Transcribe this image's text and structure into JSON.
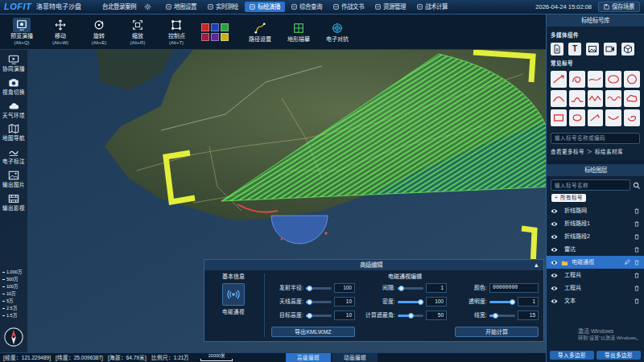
{
  "app": {
    "logo": "LOFIT",
    "title": "洛菲特电子沙盘",
    "scene": "台北登录案例",
    "datetime": "2026-04-24 15:02:08",
    "save": "保存场景"
  },
  "menu": [
    {
      "label": "地图设置",
      "selected": false
    },
    {
      "label": "实时测绘",
      "selected": false
    },
    {
      "label": "标绘演播",
      "selected": true
    },
    {
      "label": "综合查询",
      "selected": false
    },
    {
      "label": "作战文书",
      "selected": false
    },
    {
      "label": "资源管理",
      "selected": false
    },
    {
      "label": "战术计算",
      "selected": false
    }
  ],
  "tools": [
    {
      "label": "预览演播",
      "key": "(Alt+Q)",
      "kind": "preview"
    },
    {
      "label": "移动",
      "key": "(Alt+W)",
      "kind": "move"
    },
    {
      "label": "旋转",
      "key": "(Alt+E)",
      "kind": "rotate"
    },
    {
      "label": "缩放",
      "key": "(Alt+R)",
      "kind": "scale"
    },
    {
      "label": "控制点",
      "key": "(Alt+T)",
      "kind": "points"
    }
  ],
  "swatches": [
    {
      "color": "#c62828"
    },
    {
      "color": "#1e40b0"
    },
    {
      "color": "#2e9e3f"
    },
    {
      "color": "#a01e3c"
    },
    {
      "color": "#5b2a9a"
    },
    {
      "color": "#c9b21c"
    }
  ],
  "tools_extra": [
    {
      "label": "路径设置",
      "kind": "path"
    },
    {
      "label": "地形描摹",
      "kind": "terrain"
    },
    {
      "label": "电子对抗",
      "kind": "ecm"
    }
  ],
  "sidebar": {
    "items": [
      {
        "label": "协同演播",
        "kind": "collab"
      },
      {
        "label": "视角切换",
        "kind": "view"
      },
      {
        "label": "天气环境",
        "kind": "weather"
      },
      {
        "label": "地图导航",
        "kind": "nav"
      },
      {
        "label": "电子标注",
        "kind": "annotate"
      },
      {
        "label": "输出图片",
        "kind": "export_image"
      },
      {
        "label": "输出影视",
        "kind": "export_video"
      }
    ]
  },
  "scale_ticks": [
    "1,000万",
    "500万",
    "100万",
    "10万",
    "5万",
    "2.5万",
    "1.5万"
  ],
  "editor": {
    "title": "高级编辑",
    "collapse": "▲",
    "basic_title": "基本信息",
    "object": "电磁通视",
    "section": "电磁通视编辑",
    "fields": [
      {
        "label": "发射半径:",
        "value": "100",
        "level": 0.02,
        "kind": "slider"
      },
      {
        "label": "间隔:",
        "value": "1",
        "level": 0.02,
        "kind": "slider"
      },
      {
        "label": "颜色:",
        "value": "00000000",
        "kind": "text"
      },
      {
        "label": "天线高度:",
        "value": "10",
        "level": 0.02,
        "kind": "slider"
      },
      {
        "label": "密度:",
        "value": "100",
        "level": 1,
        "kind": "slider"
      },
      {
        "label": "透明度:",
        "value": "1",
        "level": 1,
        "kind": "slider"
      },
      {
        "label": "目标高度:",
        "value": "10",
        "level": 0.02,
        "kind": "slider"
      },
      {
        "label": "计算遮蔽角:",
        "value": "50",
        "level": 0.5,
        "kind": "slider"
      },
      {
        "label": "线宽:",
        "value": "15",
        "level": 0.15,
        "kind": "slider"
      }
    ],
    "buttons": [
      "导出KML\\KMZ",
      "开始计算"
    ]
  },
  "status_bar": {
    "items": [
      "[经度：121.229489]",
      "[纬度：25.0096387]",
      "[海拔：64.79米]",
      "比例尺：1:21万"
    ],
    "scale_bar": "20000米",
    "tabs": [
      {
        "label": "高级编辑",
        "selected": true
      },
      {
        "label": "动画编辑",
        "selected": false
      }
    ]
  },
  "library": {
    "title": "标绘标号库",
    "media_title": "多媒体组件",
    "media": [
      {
        "kind": "doc"
      },
      {
        "kind": "text",
        "label": "T"
      },
      {
        "kind": "image"
      },
      {
        "kind": "video"
      },
      {
        "kind": "cube"
      }
    ],
    "symbols_title": "常见标号",
    "symbols": [
      {
        "kind": "arrow"
      },
      {
        "kind": "loop"
      },
      {
        "kind": "curve"
      },
      {
        "kind": "ellipse"
      },
      {
        "kind": "circle"
      },
      {
        "kind": "arc"
      },
      {
        "kind": "bump"
      },
      {
        "kind": "zigzag"
      },
      {
        "kind": "wave"
      },
      {
        "kind": "cloud"
      },
      {
        "kind": "box"
      },
      {
        "kind": "blob"
      },
      {
        "kind": "hook"
      },
      {
        "kind": "curl"
      },
      {
        "kind": "spiral"
      }
    ],
    "search": {
      "placeholder": "输入标号名称或编码"
    },
    "more": "查看更多标号",
    "more_arrow": "＞",
    "assets": "标绘素材库"
  },
  "layers": {
    "title": "标绘图层",
    "search": {
      "placeholder": "输入标号名称"
    },
    "tooltip": {
      "icon": "+",
      "label": "所有标号"
    },
    "items": [
      {
        "label": "折线路网",
        "visible": true,
        "selected": false,
        "kind": "file"
      },
      {
        "label": "折线路段1",
        "visible": true,
        "selected": false,
        "kind": "file"
      },
      {
        "label": "折线路段2",
        "visible": true,
        "selected": false,
        "kind": "file"
      },
      {
        "label": "雷达",
        "visible": true,
        "selected": false,
        "kind": "file"
      },
      {
        "label": "电磁通视",
        "visible": true,
        "selected": true,
        "kind": "folder"
      },
      {
        "label": "工程兵",
        "visible": true,
        "selected": false,
        "kind": "file"
      },
      {
        "label": "工程兵",
        "visible": true,
        "selected": false,
        "kind": "file"
      },
      {
        "label": "文本",
        "visible": true,
        "selected": false,
        "kind": "file"
      }
    ],
    "buttons": [
      "导入多边形",
      "导出多边形"
    ]
  },
  "watermark": {
    "title": "激活 Windows",
    "hint": "转到“设置”以激活 Windows。"
  }
}
